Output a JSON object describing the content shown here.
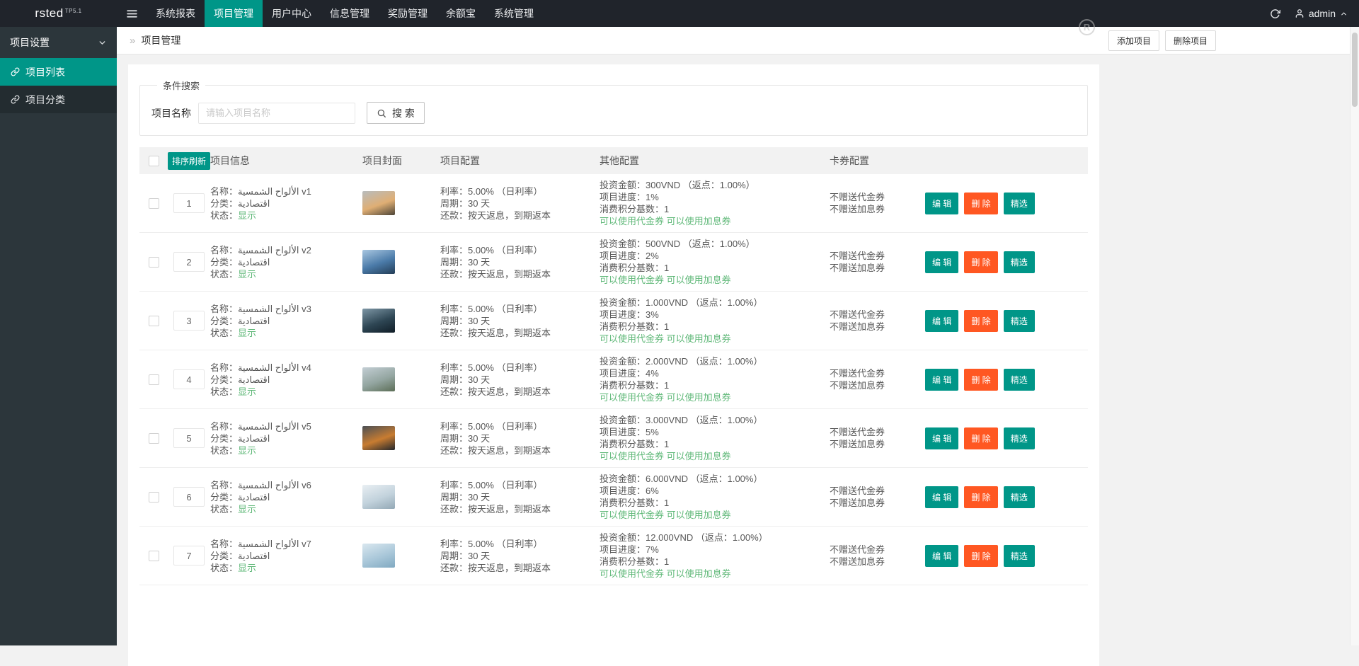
{
  "topbar": {
    "logo": "rsted",
    "logo_version": "TP5.1",
    "nav": [
      {
        "key": "system-report",
        "label": "系统报表",
        "active": false
      },
      {
        "key": "project-manage",
        "label": "项目管理",
        "active": true
      },
      {
        "key": "user-center",
        "label": "用户中心",
        "active": false
      },
      {
        "key": "info-manage",
        "label": "信息管理",
        "active": false
      },
      {
        "key": "reward-manage",
        "label": "奖励管理",
        "active": false
      },
      {
        "key": "yuebao",
        "label": "余额宝",
        "active": false
      },
      {
        "key": "system-manage",
        "label": "系统管理",
        "active": false
      }
    ],
    "username": "admin"
  },
  "sidebar": {
    "section_title": "项目设置",
    "items": [
      {
        "key": "project-list",
        "label": "项目列表",
        "active": true
      },
      {
        "key": "project-category",
        "label": "项目分类",
        "active": false
      }
    ]
  },
  "breadcrumb": {
    "current": "项目管理"
  },
  "page_actions": {
    "add": "添加项目",
    "remove": "删除项目"
  },
  "watermark": "R",
  "search": {
    "legend": "条件搜索",
    "name_label": "项目名称",
    "placeholder": "请输入项目名称",
    "button_label": "搜 索"
  },
  "table": {
    "sort_refresh_label": "排序刷新",
    "headers": {
      "info": "项目信息",
      "cover": "项目封面",
      "config": "项目配置",
      "other": "其他配置",
      "card": "卡券配置"
    },
    "labels": {
      "name": "名称：",
      "category": "分类：",
      "status": "状态：",
      "rate": "利率：",
      "cycle": "周期：",
      "repay": "还款：",
      "invest": "投资金额：",
      "progress": "项目进度：",
      "points": "消费积分基数："
    },
    "actions": {
      "edit": "编 辑",
      "delete": "删 除",
      "featured": "精选"
    },
    "colors": {
      "accent": "#009688",
      "danger": "#FF5722",
      "ok_text": "#5FB878"
    },
    "rows": [
      {
        "sort": "1",
        "name": "الألواح الشمسية v1",
        "category": "اقتصادية",
        "status": "显示",
        "rate": "5.00% （日利率）",
        "cycle": "30 天",
        "repay": "按天返息，到期返本",
        "invest": "300VND （返点：1.00%）",
        "progress": "1%",
        "points": "1",
        "coupons": "可以使用代金券 可以使用加息券",
        "card1": "不赠送代金券",
        "card2": "不赠送加息券",
        "cover_colors": [
          "#b8bcbd",
          "#dfae74",
          "#4c4437"
        ]
      },
      {
        "sort": "2",
        "name": "الألواح الشمسية v2",
        "category": "اقتصادية",
        "status": "显示",
        "rate": "5.00% （日利率）",
        "cycle": "30 天",
        "repay": "按天返息，到期返本",
        "invest": "500VND （返点：1.00%）",
        "progress": "2%",
        "points": "1",
        "coupons": "可以使用代金券 可以使用加息券",
        "card1": "不赠送代金券",
        "card2": "不赠送加息券",
        "cover_colors": [
          "#a9c7e1",
          "#4a7aa8",
          "#243e57"
        ]
      },
      {
        "sort": "3",
        "name": "الألواح الشمسية v3",
        "category": "اقتصادية",
        "status": "显示",
        "rate": "5.00% （日利率）",
        "cycle": "30 天",
        "repay": "按天返息，到期返本",
        "invest": "1.000VND （返点：1.00%）",
        "progress": "3%",
        "points": "1",
        "coupons": "可以使用代金券 可以使用加息券",
        "card1": "不赠送代金券",
        "card2": "不赠送加息券",
        "cover_colors": [
          "#7e97a6",
          "#2e4654",
          "#101d27"
        ]
      },
      {
        "sort": "4",
        "name": "الألواح الشمسية v4",
        "category": "اقتصادية",
        "status": "显示",
        "rate": "5.00% （日利率）",
        "cycle": "30 天",
        "repay": "按天返息，到期返本",
        "invest": "2.000VND （返点：1.00%）",
        "progress": "4%",
        "points": "1",
        "coupons": "可以使用代金券 可以使用加息券",
        "card1": "不赠送代金券",
        "card2": "不赠送加息券",
        "cover_colors": [
          "#c3ced4",
          "#93a5a0",
          "#5c6e57"
        ]
      },
      {
        "sort": "5",
        "name": "الألواح الشمسية v5",
        "category": "اقتصادية",
        "status": "显示",
        "rate": "5.00% （日利率）",
        "cycle": "30 天",
        "repay": "按天返息，到期返本",
        "invest": "3.000VND （返点：1.00%）",
        "progress": "5%",
        "points": "1",
        "coupons": "可以使用代金券 可以使用加息券",
        "card1": "不赠送代金券",
        "card2": "不赠送加息券",
        "cover_colors": [
          "#4a4f55",
          "#c87c31",
          "#23272c"
        ]
      },
      {
        "sort": "6",
        "name": "الألواح الشمسية v6",
        "category": "اقتصادية",
        "status": "显示",
        "rate": "5.00% （日利率）",
        "cycle": "30 天",
        "repay": "按天返息，到期返本",
        "invest": "6.000VND （返点：1.00%）",
        "progress": "6%",
        "points": "1",
        "coupons": "可以使用代金券 可以使用加息券",
        "card1": "不赠送代金券",
        "card2": "不赠送加息券",
        "cover_colors": [
          "#e9eff3",
          "#c2d2dc",
          "#93a8b5"
        ]
      },
      {
        "sort": "7",
        "name": "الألواح الشمسية v7",
        "category": "اقتصادية",
        "status": "显示",
        "rate": "5.00% （日利率）",
        "cycle": "30 天",
        "repay": "按天返息，到期返本",
        "invest": "12.000VND （返点：1.00%）",
        "progress": "7%",
        "points": "1",
        "coupons": "可以使用代金券 可以使用加息券",
        "card1": "不赠送代金券",
        "card2": "不赠送加息券",
        "cover_colors": [
          "#d9e7ef",
          "#a9c7d9",
          "#80a9c1"
        ]
      }
    ]
  }
}
